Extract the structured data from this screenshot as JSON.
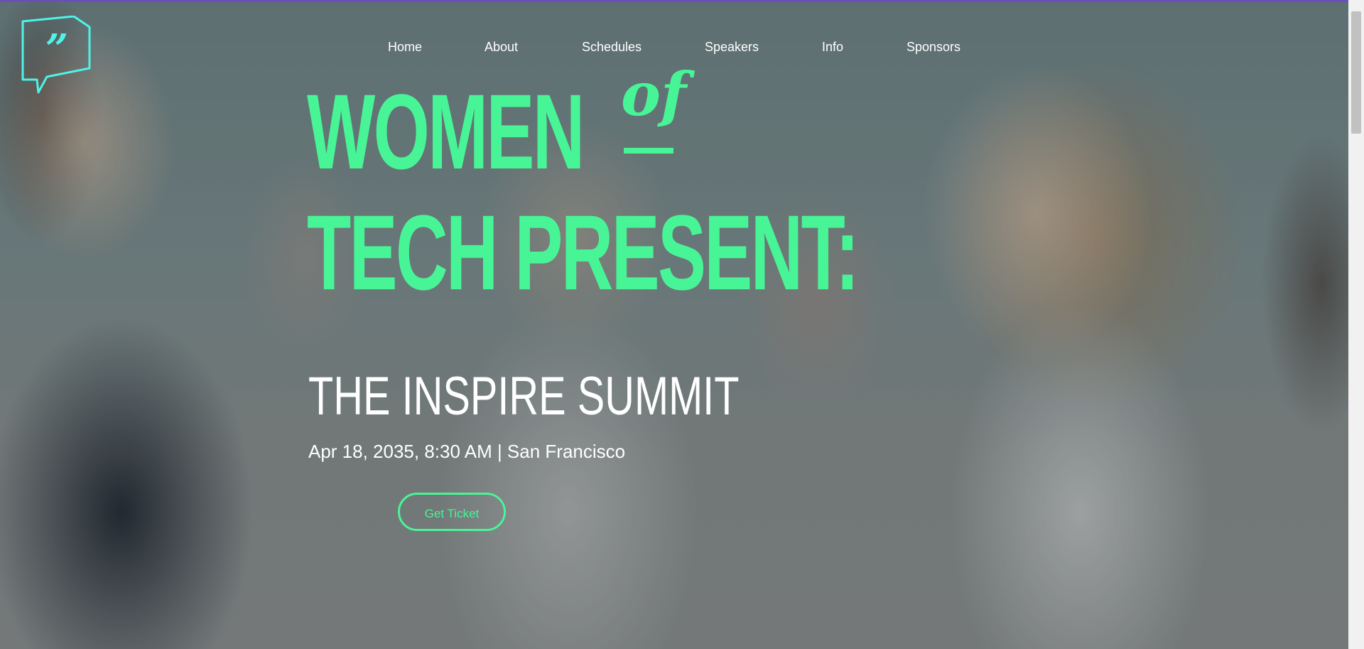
{
  "logo": {
    "icon": "quote-speech-bubble-icon",
    "color": "#4ef3e6"
  },
  "nav": {
    "items": [
      {
        "label": "Home"
      },
      {
        "label": "About"
      },
      {
        "label": "Schedules"
      },
      {
        "label": "Speakers"
      },
      {
        "label": "Info"
      },
      {
        "label": "Sponsors"
      }
    ]
  },
  "hero": {
    "headline_word1": "WOMEN",
    "headline_of": "of",
    "headline_line2": "TECH PRESENT:",
    "subtitle": "THE INSPIRE SUMMIT",
    "event_info": "Apr 18, 2035, 8:30 AM | San Francisco",
    "cta_label": "Get Ticket"
  },
  "colors": {
    "accent_green": "#48f596",
    "logo_cyan": "#4ef3e6",
    "top_accent": "#6a4fb6",
    "text_white": "#ffffff"
  }
}
